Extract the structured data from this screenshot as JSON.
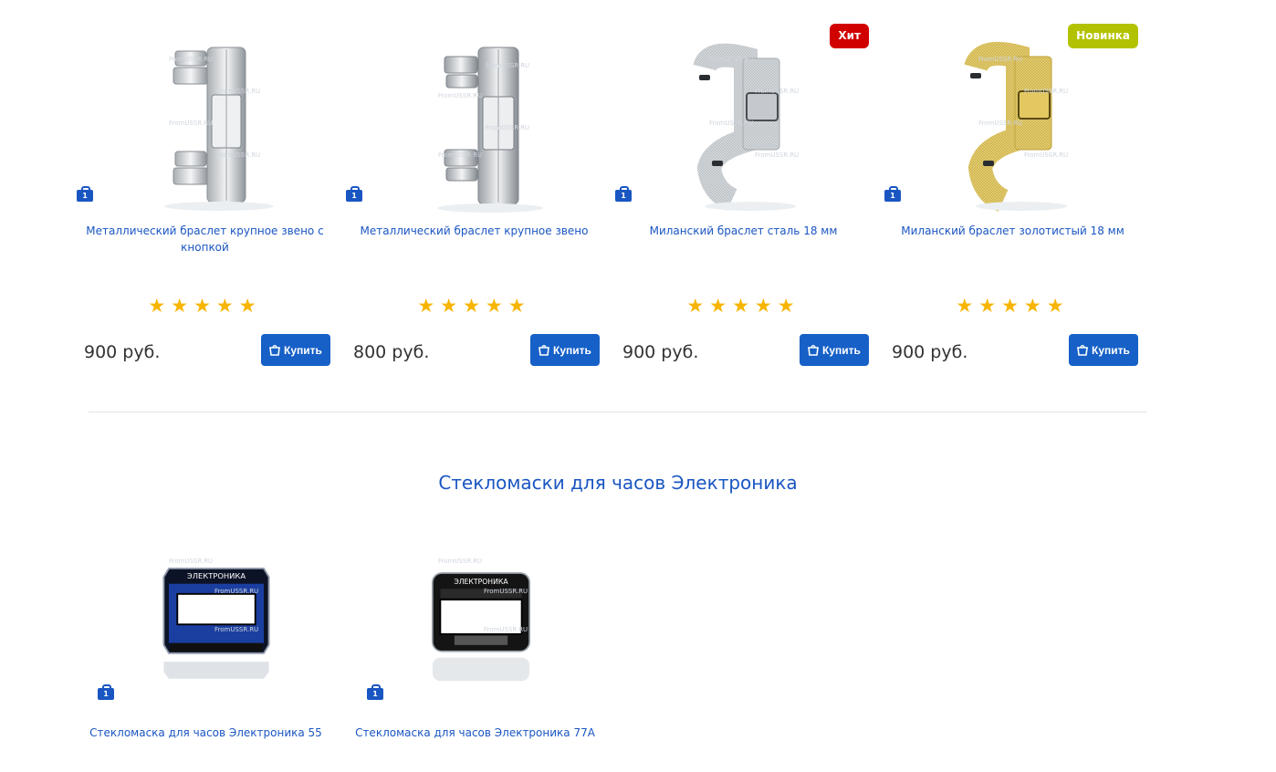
{
  "product_row": [
    {
      "title": "Металлический браслет крупное звено с кнопкой",
      "stock": "1",
      "price": "900 руб.",
      "buy_label": "Купить",
      "rating": 5,
      "badge": "",
      "image": "steel-link-bracelet-button"
    },
    {
      "title": "Металлический браслет крупное звено",
      "stock": "1",
      "price": "800 руб.",
      "buy_label": "Купить",
      "rating": 5,
      "badge": "",
      "image": "steel-link-bracelet"
    },
    {
      "title": "Миланский браслет сталь 18 мм",
      "stock": "1",
      "price": "900 руб.",
      "buy_label": "Купить",
      "rating": 5,
      "badge": "Хит",
      "image": "milanese-steel"
    },
    {
      "title": "Миланский браслет золотистый 18 мм",
      "stock": "1",
      "price": "900 руб.",
      "buy_label": "Купить",
      "rating": 5,
      "badge": "Новинка",
      "image": "milanese-gold"
    }
  ],
  "section": {
    "title": "Стекломаски для часов Электроника"
  },
  "glass_row": [
    {
      "title": "Стекломаска для часов Электроника 55",
      "stock": "1",
      "image": "glass-mask-55"
    },
    {
      "title": "Стекломаска для часов Электроника 77А",
      "stock": "1",
      "image": "glass-mask-77a"
    }
  ],
  "watermark": "FromUSSR.RU",
  "colors": {
    "link": "#1a56c2",
    "button": "#1660c7",
    "star": "#f7b500",
    "hit": "#d10000",
    "new": "#b3c200"
  }
}
